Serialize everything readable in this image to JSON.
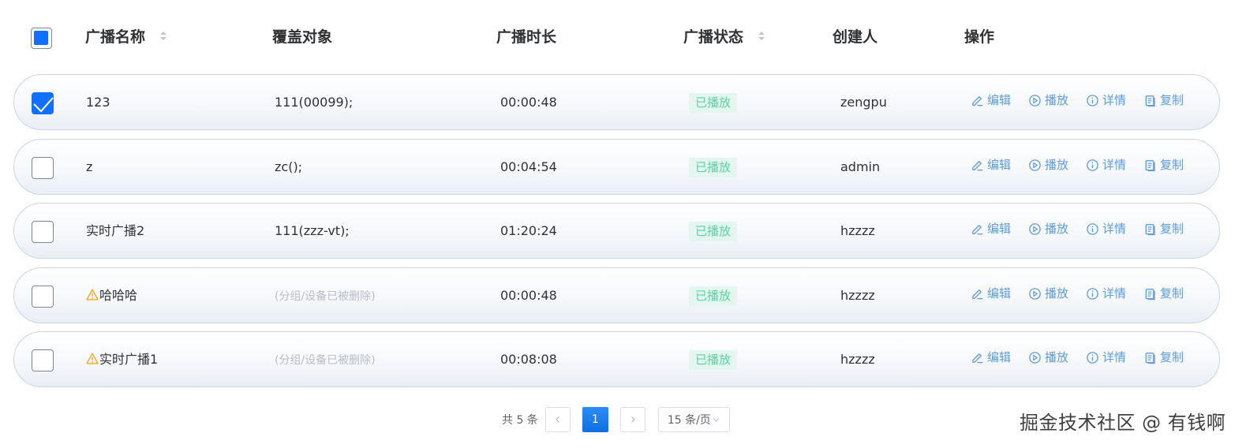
{
  "table": {
    "columns": {
      "name": "广播名称",
      "cover": "覆盖对象",
      "duration": "广播时长",
      "status": "广播状态",
      "creator": "创建人",
      "actions": "操作"
    },
    "rows": [
      {
        "checked": true,
        "name": "123",
        "warning": false,
        "cover": "111(00099);",
        "cover_muted": false,
        "duration": "00:00:48",
        "status": "已播放",
        "creator": "zengpu"
      },
      {
        "checked": false,
        "name": "z",
        "warning": false,
        "cover": "zc();",
        "cover_muted": false,
        "duration": "00:04:54",
        "status": "已播放",
        "creator": "admin"
      },
      {
        "checked": false,
        "name": "实时广播2",
        "warning": false,
        "cover": "111(zzz-vt);",
        "cover_muted": false,
        "duration": "01:20:24",
        "status": "已播放",
        "creator": "hzzzz"
      },
      {
        "checked": false,
        "name": "哈哈哈",
        "warning": true,
        "cover": "(分组/设备已被删除)",
        "cover_muted": true,
        "duration": "00:00:48",
        "status": "已播放",
        "creator": "hzzzz"
      },
      {
        "checked": false,
        "name": "实时广播1",
        "warning": true,
        "cover": "(分组/设备已被删除)",
        "cover_muted": true,
        "duration": "00:08:08",
        "status": "已播放",
        "creator": "hzzzz"
      }
    ],
    "action_labels": {
      "edit": "编辑",
      "play": "播放",
      "detail": "详情",
      "copy": "复制"
    }
  },
  "pagination": {
    "total_text": "共 5 条",
    "current_page": "1",
    "page_size": "15 条/页"
  },
  "watermark": "掘金技术社区 @ 有钱啊",
  "colors": {
    "primary": "#1170ff",
    "action": "#5e9bdb",
    "status_text": "#5fd0a8",
    "status_bg": "#e3f6ef",
    "warning": "#f5a623"
  },
  "icons": {
    "edit": "edit-icon",
    "play": "play-circle-icon",
    "detail": "info-circle-icon",
    "copy": "copy-icon",
    "warning": "warning-triangle-icon"
  }
}
